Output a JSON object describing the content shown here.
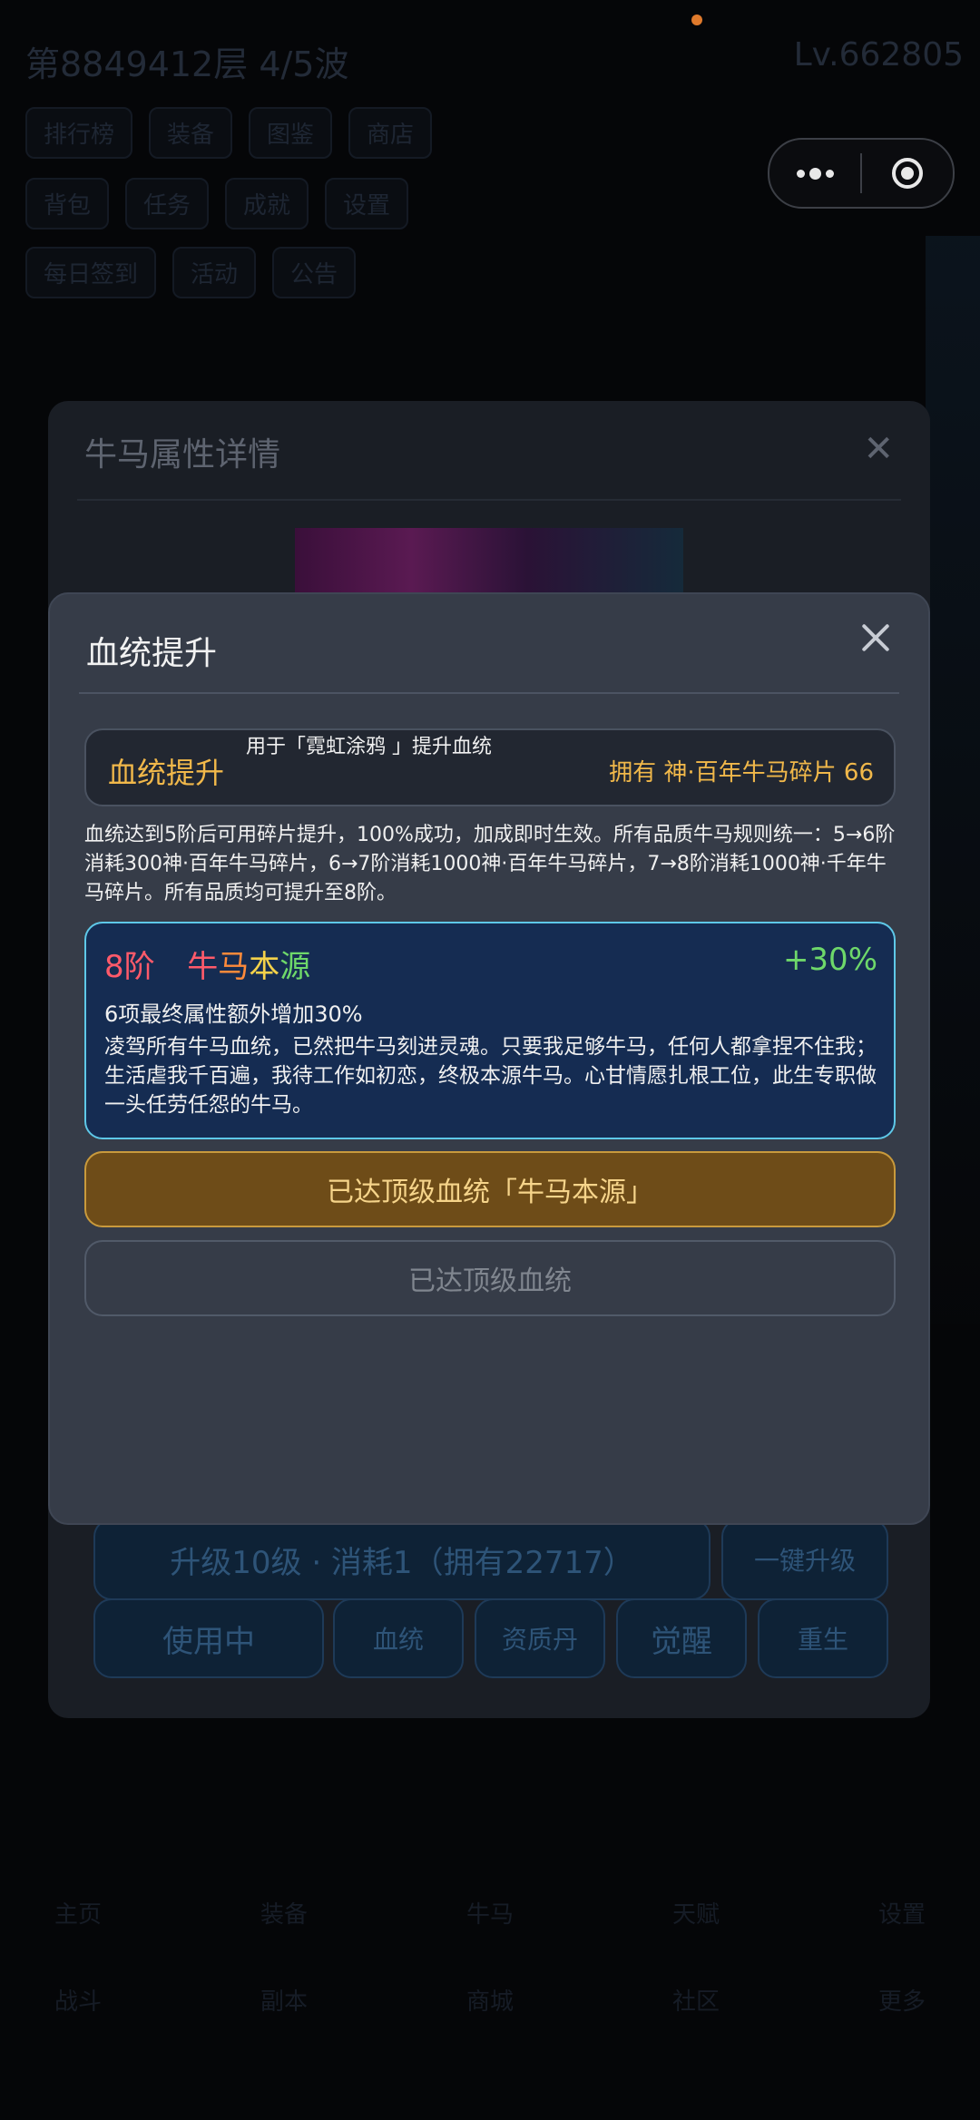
{
  "status": {
    "indicator_color": "#e07a2c"
  },
  "background": {
    "title": "第8849412层  4/5波",
    "level": "Lv.662805",
    "tab_row_1": [
      "排行榜",
      "装备",
      "图鉴",
      "商店"
    ],
    "tab_row_2": [
      "背包",
      "任务",
      "成就",
      "设置"
    ],
    "tab_row_3": [
      "每日签到",
      "活动",
      "公告"
    ],
    "bottom_row_1": [
      "主页",
      "装备",
      "牛马",
      "天赋",
      "设置"
    ],
    "bottom_row_2": [
      "战斗",
      "副本",
      "商城",
      "社区",
      "更多"
    ]
  },
  "capsule": {
    "more_icon": "more-dots-icon",
    "close_icon": "target-close-icon"
  },
  "detail_modal": {
    "title": "牛马属性详情",
    "close_label": "✕",
    "upgrade_label": "升级10级 · 消耗1（拥有22717）",
    "one_key_label": "一键升级",
    "buttons": [
      "使用中",
      "血统",
      "资质丹",
      "觉醒",
      "重生"
    ]
  },
  "bloodline_modal": {
    "title": "血统提升",
    "info": {
      "label": "血统提升",
      "subtitle": "用于「霓虹涂鸦 」提升血统",
      "owned": "拥有 神·百年牛马碎片 66"
    },
    "description": "血统达到5阶后可用碎片提升，100%成功，加成即时生效。所有品质牛马规则统一：5→6阶消耗300神·百年牛马碎片，6→7阶消耗1000神·百年牛马碎片，7→8阶消耗1000神·千年牛马碎片。所有品质均可提升至8阶。",
    "tier": {
      "level": "8阶",
      "name_parts": [
        "牛",
        "马",
        "本",
        "源"
      ],
      "bonus": "+30%",
      "effect": "6项最终属性额外增加30%",
      "lore": "凌驾所有牛马血统，已然把牛马刻进灵魂。只要我足够牛马，任何人都拿捏不住我；生活虐我千百遍，我待工作如初恋，终极本源牛马。心甘情愿扎根工位，此生专职做一头任劳任怨的牛马。"
    },
    "top_status_button": "已达顶级血统「牛马本源」",
    "max_button": "已达顶级血统"
  },
  "colors": {
    "gold": "#f1b84a",
    "tier_border": "#5ec8e8",
    "tier_bg": "#152c52",
    "green": "#6ed86a",
    "red": "#ff5a6a"
  }
}
